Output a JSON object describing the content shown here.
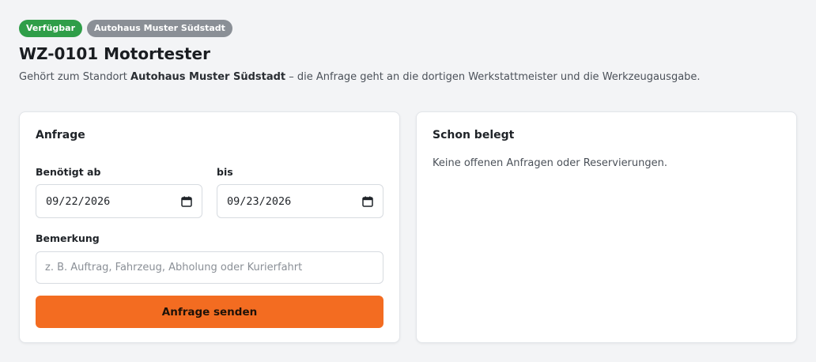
{
  "badges": {
    "status": "Verfügbar",
    "location": "Autohaus Muster Südstadt"
  },
  "tool": {
    "title": "WZ-0101 Motortester",
    "subtitle_prefix": "Gehört zum Standort ",
    "subtitle_location": "Autohaus Muster Südstadt",
    "subtitle_suffix": " – die Anfrage geht an die dortigen Werkstattmeister und die Werkzeugausgabe."
  },
  "request": {
    "heading": "Anfrage",
    "from_label": "Benötigt ab",
    "from_value": "09/22/2026",
    "to_label": "bis",
    "to_value": "09/23/2026",
    "note_label": "Bemerkung",
    "note_placeholder": "z. B. Auftrag, Fahrzeug, Abholung oder Kurierfahrt",
    "submit_label": "Anfrage senden"
  },
  "occupied": {
    "heading": "Schon belegt",
    "empty_text": "Keine offenen Anfragen oder Reservierungen."
  },
  "colors": {
    "accent": "#f36c21",
    "status_green": "#2f9e48",
    "badge_gray": "#8a8f96"
  },
  "icons": {
    "date_picker": "calendar-icon"
  }
}
